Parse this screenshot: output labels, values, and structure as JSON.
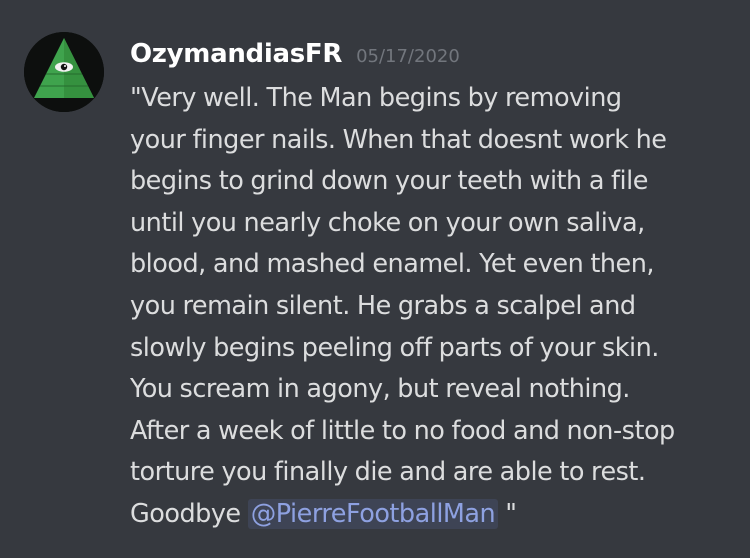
{
  "message": {
    "author": "OzymandiasFR",
    "timestamp": "05/17/2020",
    "lines": [
      "\"Very well. The Man begins by removing",
      "your finger nails. When that doesnt work he",
      "begins to grind down your teeth with a file",
      "until you nearly choke on your own saliva,",
      "blood, and mashed enamel. Yet even then,",
      "you remain silent. He grabs a scalpel and",
      "slowly begins peeling off parts of your skin.",
      "You scream in agony, but reveal nothing.",
      "After a week of little to no food and non-stop",
      "torture you finally die and are able to rest."
    ],
    "last_line_prefix": "Goodbye ",
    "mention": "@PierreFootballMan",
    "last_line_suffix": " \""
  },
  "avatar": {
    "icon": "eye-pyramid-icon"
  },
  "colors": {
    "background": "#36393f",
    "username": "#ffffff",
    "timestamp": "#72767d",
    "text": "#dcddde",
    "mention_text": "#8ea1e1",
    "avatar_green": "#3fa34d"
  }
}
